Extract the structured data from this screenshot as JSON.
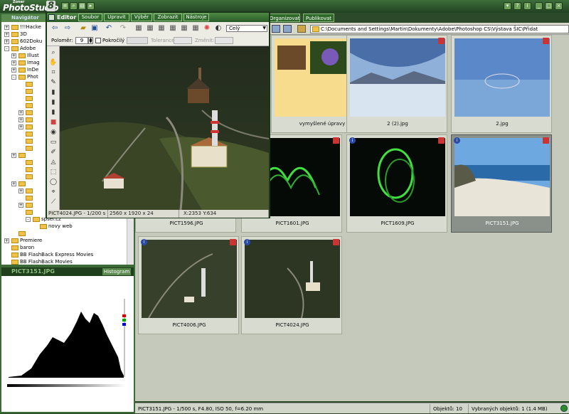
{
  "app": {
    "logo_small": "Zoner",
    "logo_big": "PhotoStudio",
    "logo_num": "8"
  },
  "navigator": {
    "title": "Navigátor"
  },
  "tree": [
    {
      "label": "!!!Hacke",
      "indent": 1,
      "exp": "+"
    },
    {
      "label": "3D",
      "indent": 1,
      "exp": "+"
    },
    {
      "label": "602Doku",
      "indent": 1,
      "exp": "+"
    },
    {
      "label": "Adobe",
      "indent": 1,
      "exp": "-"
    },
    {
      "label": "Illust",
      "indent": 2,
      "exp": "+"
    },
    {
      "label": "Imag",
      "indent": 2,
      "exp": "+"
    },
    {
      "label": "InDe",
      "indent": 2,
      "exp": "+"
    },
    {
      "label": "Phot",
      "indent": 2,
      "exp": "-"
    },
    {
      "label": "",
      "indent": 3,
      "exp": ""
    },
    {
      "label": "",
      "indent": 3,
      "exp": ""
    },
    {
      "label": "",
      "indent": 3,
      "exp": ""
    },
    {
      "label": "",
      "indent": 3,
      "exp": ""
    },
    {
      "label": "",
      "indent": 3,
      "exp": "+"
    },
    {
      "label": "",
      "indent": 3,
      "exp": "+"
    },
    {
      "label": "",
      "indent": 3,
      "exp": "+"
    },
    {
      "label": "",
      "indent": 3,
      "exp": ""
    },
    {
      "label": "",
      "indent": 3,
      "exp": ""
    },
    {
      "label": "",
      "indent": 3,
      "exp": ""
    },
    {
      "label": "",
      "indent": 2,
      "exp": "+"
    },
    {
      "label": "",
      "indent": 3,
      "exp": ""
    },
    {
      "label": "",
      "indent": 3,
      "exp": ""
    },
    {
      "label": "",
      "indent": 3,
      "exp": ""
    },
    {
      "label": "",
      "indent": 2,
      "exp": "+"
    },
    {
      "label": "",
      "indent": 3,
      "exp": "+"
    },
    {
      "label": "",
      "indent": 3,
      "exp": ""
    },
    {
      "label": "",
      "indent": 3,
      "exp": "+"
    },
    {
      "label": "",
      "indent": 3,
      "exp": ""
    },
    {
      "label": "spsei.cz",
      "indent": 4,
      "exp": "-"
    },
    {
      "label": "novy web",
      "indent": 5,
      "exp": ""
    },
    {
      "label": "",
      "indent": 2,
      "exp": ""
    },
    {
      "label": "Premiere",
      "indent": 1,
      "exp": "+"
    },
    {
      "label": "baron",
      "indent": 1,
      "exp": ""
    },
    {
      "label": "BB FlashBack Express Movies",
      "indent": 1,
      "exp": ""
    },
    {
      "label": "BB FlashBack Movies",
      "indent": 1,
      "exp": ""
    }
  ],
  "histogram": {
    "title": "PICT3151.JPG",
    "button": "Histogram"
  },
  "editor": {
    "title": "Editor",
    "menus": [
      "Soubor",
      "Upravit",
      "Výběr",
      "Zobrazit",
      "Nástroje"
    ],
    "radius_label": "Poloměr:",
    "radius_value": "9",
    "advanced_label": "Pokročilý",
    "tolerance_label": "Tolerance:",
    "change_label": "Změnit:",
    "combo": "Celý",
    "status_name": "PICT4024.JPG - 1/200 s",
    "status_size": "2560 x 1920 x 24",
    "status_coords": "X:2353  Y:634"
  },
  "mainmenu": [
    "Organizovat",
    "Publikovat"
  ],
  "path": "C:\\Documents and Settings\\Martin\\Dokumenty\\Adobe\\Photoshop CS\\Výstava ŠIC\\Přidat",
  "thumbs": [
    {
      "caption": "vymyšlené úpravy",
      "kind": "folder",
      "selected": false
    },
    {
      "caption": "2 (2).jpg",
      "kind": "lake",
      "selected": false
    },
    {
      "caption": "2.jpg",
      "kind": "sky",
      "selected": false
    },
    {
      "caption": "PICT1596.JPG",
      "kind": "green",
      "selected": false
    },
    {
      "caption": "PICT1601.JPG",
      "kind": "green",
      "selected": false
    },
    {
      "caption": "PICT1609.JPG",
      "kind": "green2",
      "selected": false
    },
    {
      "caption": "PICT3151.JPG",
      "kind": "sea",
      "selected": true
    },
    {
      "caption": "PICT4006.JPG",
      "kind": "aerial",
      "selected": false
    },
    {
      "caption": "PICT4024.JPG",
      "kind": "aerial2",
      "selected": false
    }
  ],
  "status": {
    "info": "PICT3151.JPG - 1/500 s, F4.80, ISO 50, f=6.20 mm",
    "objects": "Objektů: 10",
    "selected": "Vybraných objektů: 1 (1.4 MB)"
  }
}
